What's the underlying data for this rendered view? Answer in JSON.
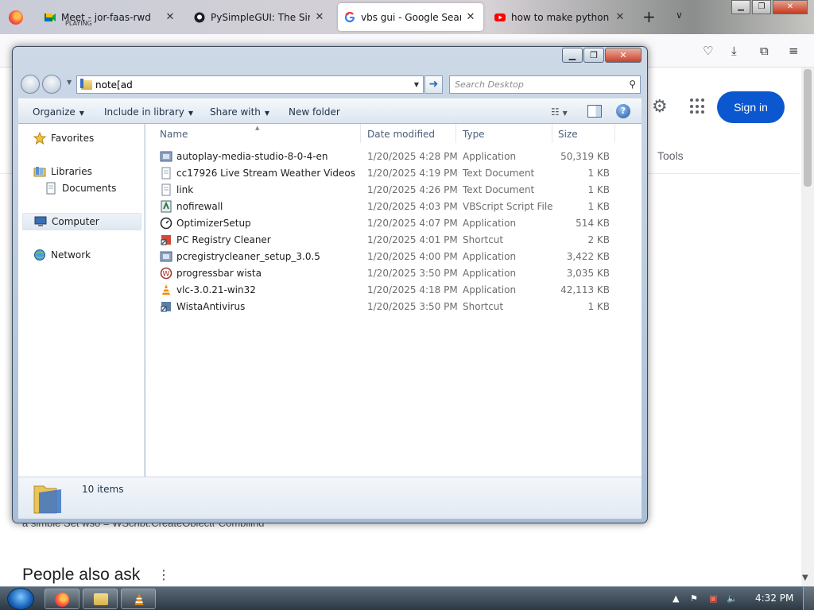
{
  "browser": {
    "tabs": [
      {
        "title": "Meet - jor-faas-rwd",
        "subtitle": "PLAYING",
        "icon": "google-meet-icon"
      },
      {
        "title": "PySimpleGUI: The Simpl",
        "icon": "github-icon"
      },
      {
        "title": "vbs gui - Google Search",
        "icon": "google-icon",
        "active": true
      },
      {
        "title": "how to make python gu",
        "icon": "youtube-icon"
      }
    ]
  },
  "google": {
    "sign_in_label": "Sign in",
    "tools_label": "Tools",
    "snippet_text": "a simple  Set wso = WScript.CreateObject( Compiling",
    "people_also_ask": "People also ask"
  },
  "explorer": {
    "address_value": "note[ad",
    "search_placeholder": "Search Desktop",
    "toolbar": {
      "organize": "Organize",
      "include_in_library": "Include in library",
      "share_with": "Share with",
      "new_folder": "New folder"
    },
    "nav": {
      "favorites": "Favorites",
      "libraries": "Libraries",
      "documents": "Documents",
      "computer": "Computer",
      "network": "Network"
    },
    "columns": {
      "name": "Name",
      "date": "Date modified",
      "type": "Type",
      "size": "Size"
    },
    "files": [
      {
        "name": "autoplay-media-studio-8-0-4-en",
        "date": "1/20/2025 4:28 PM",
        "type": "Application",
        "size": "50,319 KB",
        "icon": "installer-icon"
      },
      {
        "name": "cc17926 Live Stream Weather Videos",
        "date": "1/20/2025 4:19 PM",
        "type": "Text Document",
        "size": "1 KB",
        "icon": "text-document-icon"
      },
      {
        "name": "link",
        "date": "1/20/2025 4:26 PM",
        "type": "Text Document",
        "size": "1 KB",
        "icon": "text-document-icon"
      },
      {
        "name": "nofirewall",
        "date": "1/20/2025 4:03 PM",
        "type": "VBScript Script File",
        "size": "1 KB",
        "icon": "vbscript-icon"
      },
      {
        "name": "OptimizerSetup",
        "date": "1/20/2025 4:07 PM",
        "type": "Application",
        "size": "514 KB",
        "icon": "gauge-icon"
      },
      {
        "name": "PC Registry Cleaner",
        "date": "1/20/2025 4:01 PM",
        "type": "Shortcut",
        "size": "2 KB",
        "icon": "shortcut-icon"
      },
      {
        "name": "pcregistrycleaner_setup_3.0.5",
        "date": "1/20/2025 4:00 PM",
        "type": "Application",
        "size": "3,422 KB",
        "icon": "installer-icon"
      },
      {
        "name": "progressbar wista",
        "date": "1/20/2025 3:50 PM",
        "type": "Application",
        "size": "3,035 KB",
        "icon": "app-w-icon"
      },
      {
        "name": "vlc-3.0.21-win32",
        "date": "1/20/2025 4:18 PM",
        "type": "Application",
        "size": "42,113 KB",
        "icon": "vlc-icon"
      },
      {
        "name": "WistaAntivirus",
        "date": "1/20/2025 3:50 PM",
        "type": "Shortcut",
        "size": "1 KB",
        "icon": "shortcut-icon"
      }
    ],
    "item_count": "10 items"
  },
  "taskbar": {
    "clock": "4:32 PM"
  }
}
